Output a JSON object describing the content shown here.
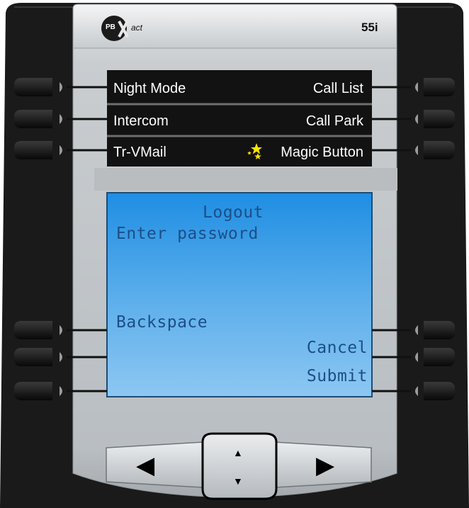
{
  "device": {
    "brand_logo": "PBXact",
    "brand_registered": "®",
    "model": "55i"
  },
  "programmable_keys": {
    "left": [
      {
        "label": "Night Mode"
      },
      {
        "label": "Intercom"
      },
      {
        "label": "Tr-VMail"
      }
    ],
    "right": [
      {
        "label": "Call List"
      },
      {
        "label": "Call Park"
      },
      {
        "label": "Magic Button",
        "icon": "stars-icon"
      }
    ]
  },
  "lcd": {
    "title": "Logout",
    "prompt": "Enter password",
    "softkeys_left": [
      "Backspace"
    ],
    "softkeys_right": [
      "Cancel",
      "Submit"
    ]
  },
  "navigation": {
    "left": "◀",
    "up": "▲",
    "down": "▼",
    "right": "▶"
  },
  "colors": {
    "bezel": "#1a1a1a",
    "faceplate": "#c5c9cd",
    "lcd": "#3ea3e8",
    "lcd_text": "#1c4e86",
    "key_panel": "#121212",
    "star": "#ffe400"
  }
}
